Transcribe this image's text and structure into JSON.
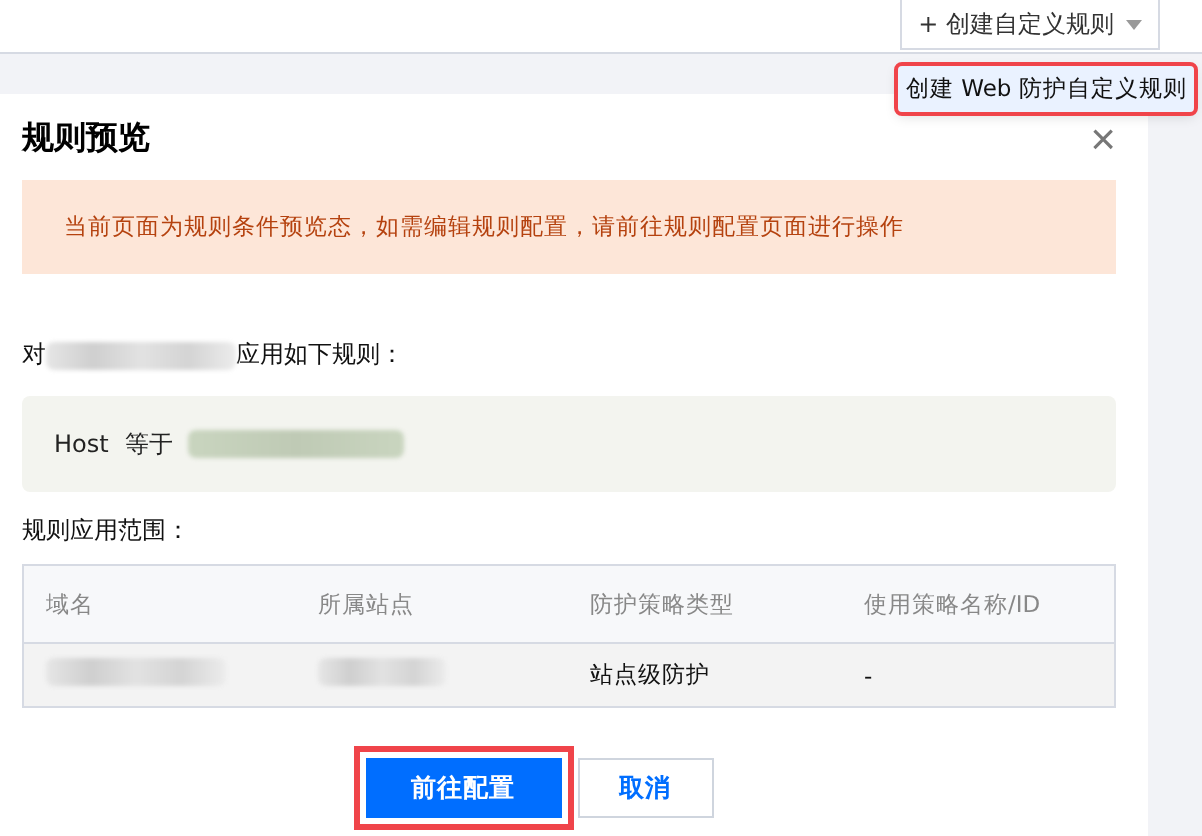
{
  "toolbar": {
    "create_button": {
      "label": "+ 创建自定义规则"
    }
  },
  "dropdown": {
    "items": [
      {
        "label": "创建 Web 防护自定义规则",
        "highlighted": true
      }
    ]
  },
  "dialog": {
    "title": "规则预览",
    "close": "×",
    "alert": "当前页面为规则条件预览态，如需编辑规则配置，请前往规则配置页面进行操作",
    "target_prefix": "对",
    "target_suffix": "应用如下规则：",
    "condition": {
      "field": "Host",
      "operator": "等于"
    },
    "scope_label": "规则应用范围：",
    "table": {
      "columns": [
        "域名",
        "所属站点",
        "防护策略类型",
        "使用策略名称/ID"
      ],
      "rows": [
        [
          {
            "kind": "redacted"
          },
          {
            "kind": "redacted"
          },
          {
            "kind": "text",
            "text": "站点级防护"
          },
          {
            "kind": "text",
            "text": "-"
          }
        ]
      ]
    },
    "buttons": [
      {
        "label": "前往配置",
        "kind": "primary",
        "highlighted": true
      },
      {
        "label": "取消",
        "kind": "secondary",
        "highlighted": false
      }
    ]
  }
}
